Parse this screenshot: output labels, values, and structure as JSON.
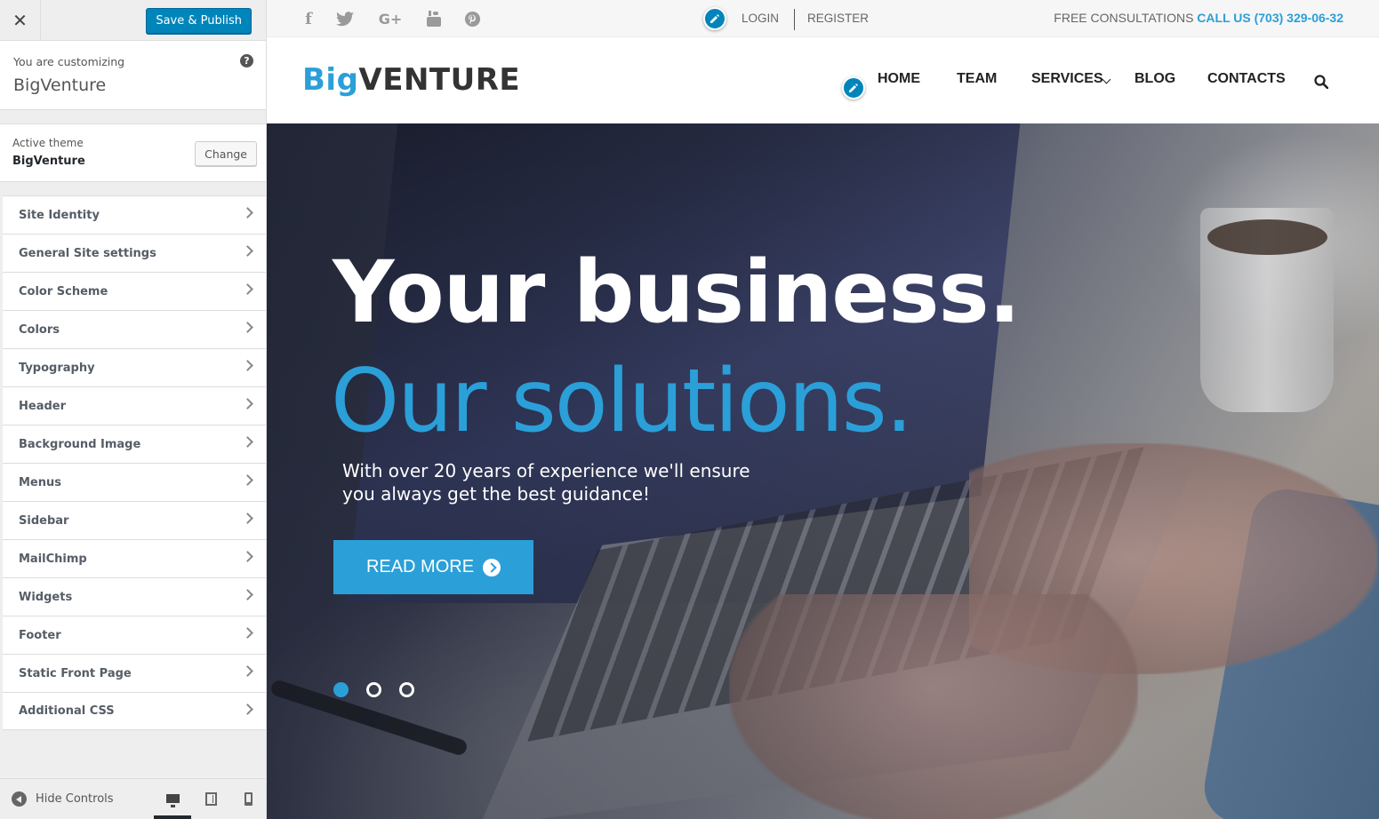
{
  "customizer": {
    "close_icon": "close-icon",
    "save_button": "Save & Publish",
    "customizing_label": "You are customizing",
    "site_name": "BigVenture",
    "help_icon": "?",
    "active_theme_label": "Active theme",
    "active_theme_name": "BigVenture",
    "change_button": "Change",
    "sections": [
      {
        "label": "Site Identity"
      },
      {
        "label": "General Site settings"
      },
      {
        "label": "Color Scheme"
      },
      {
        "label": "Colors"
      },
      {
        "label": "Typography"
      },
      {
        "label": "Header"
      },
      {
        "label": "Background Image"
      },
      {
        "label": "Menus"
      },
      {
        "label": "Sidebar"
      },
      {
        "label": "MailChimp"
      },
      {
        "label": "Widgets"
      },
      {
        "label": "Footer"
      },
      {
        "label": "Static Front Page"
      },
      {
        "label": "Additional CSS"
      }
    ],
    "hide_controls": "Hide Controls",
    "devices": [
      "desktop",
      "tablet",
      "mobile"
    ],
    "active_device": "desktop"
  },
  "preview": {
    "topbar": {
      "social_icons": [
        "facebook-icon",
        "twitter-icon",
        "google-plus-icon",
        "youtube-icon",
        "pinterest-icon"
      ],
      "login": "LOGIN",
      "register": "REGISTER",
      "consult_text": "FREE CONSULTATIONS",
      "call_text": "CALL US (703) 329-06-32"
    },
    "header": {
      "logo_part1": "Big",
      "logo_part2": "VENTURE",
      "nav": {
        "home": "HOME",
        "team": "TEAM",
        "services": "SERVICES",
        "blog": "BLOG",
        "contacts": "CONTACTS"
      }
    },
    "hero": {
      "title_line1": "Your business.",
      "title_line2": "Our solutions.",
      "subtitle": "With over 20 years of experience we'll ensure you always get the best guidance!",
      "button": "READ MORE",
      "slides": 3,
      "active_slide": 1
    }
  },
  "colors": {
    "accent": "#2b9fd8",
    "wp_button": "#0085ba",
    "sidebar_bg": "#eeeeee"
  }
}
